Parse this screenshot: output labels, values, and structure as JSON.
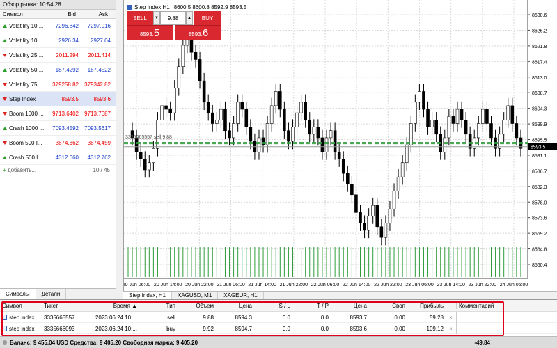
{
  "market_watch": {
    "title": "Обзор рынка: 10:54:28",
    "columns": {
      "symbol": "Символ",
      "bid": "Bid",
      "ask": "Ask"
    },
    "rows": [
      {
        "symbol": "Volatility 10 ...",
        "bid": "7296.842",
        "ask": "7297.016",
        "dir": "up",
        "color": "blue"
      },
      {
        "symbol": "Volatility 10 ...",
        "bid": "2926.34",
        "ask": "2927.04",
        "dir": "up",
        "color": "blue"
      },
      {
        "symbol": "Volatility 25 ...",
        "bid": "2011.294",
        "ask": "2011.414",
        "dir": "down",
        "color": "red"
      },
      {
        "symbol": "Volatility 50 ...",
        "bid": "187.4292",
        "ask": "187.4522",
        "dir": "up",
        "color": "blue"
      },
      {
        "symbol": "Volatility 75 ...",
        "bid": "379258.82",
        "ask": "379342.82",
        "dir": "down",
        "color": "red"
      },
      {
        "symbol": "Step Index",
        "bid": "8593.5",
        "ask": "8593.6",
        "dir": "down",
        "color": "red"
      },
      {
        "symbol": "Boom 1000 ...",
        "bid": "9713.6402",
        "ask": "9713.7687",
        "dir": "down",
        "color": "red"
      },
      {
        "symbol": "Crash 1000 ...",
        "bid": "7093.4592",
        "ask": "7093.5617",
        "dir": "up",
        "color": "blue"
      },
      {
        "symbol": "Boom 500 I...",
        "bid": "3874.362",
        "ask": "3874.459",
        "dir": "down",
        "color": "red"
      },
      {
        "symbol": "Crash 500 I...",
        "bid": "4312.660",
        "ask": "4312.762",
        "dir": "up",
        "color": "blue"
      }
    ],
    "add_label": "добавить...",
    "count": "10 / 45",
    "tabs": [
      "Символы",
      "Детали"
    ]
  },
  "chart": {
    "title": "Step Index,H1",
    "ohlc": "8600.5 8600.8 8592.9 8593.5",
    "sell_label": "SELL",
    "buy_label": "BUY",
    "lot": "9.88",
    "sell_price_small": "8593.",
    "sell_price_big": "5",
    "buy_price_small": "8593.",
    "buy_price_big": "6",
    "trade_line_label": "3335665557 sell 9.88",
    "current_price": "8593.5",
    "y_ticks": [
      "8630.6",
      "8626.2",
      "8621.8",
      "8617.4",
      "8613.0",
      "8608.7",
      "8604.3",
      "8599.9",
      "8595.5",
      "8591.1",
      "8586.7",
      "8582.3",
      "8578.0",
      "8573.6",
      "8569.2",
      "8564.8",
      "8560.4"
    ],
    "x_ticks": [
      "20 Jun 06:00",
      "20 Jun 14:00",
      "20 Jun 22:00",
      "21 Jun 06:00",
      "21 Jun 14:00",
      "21 Jun 22:00",
      "22 Jun 06:00",
      "22 Jun 14:00",
      "22 Jun 22:00",
      "23 Jun 06:00",
      "23 Jun 14:00",
      "23 Jun 22:00",
      "24 Jun 06:00"
    ],
    "tabs": [
      "Step Index, H1",
      "XAGUSD, M1",
      "XAGEUR, H1"
    ]
  },
  "trade": {
    "columns": [
      "Символ",
      "Тикет",
      "Время",
      "Тип",
      "Объем",
      "Цена",
      "S / L",
      "T / P",
      "Цена",
      "Своп",
      "Прибыль",
      "",
      "Комментарий"
    ],
    "rows": [
      {
        "symbol": "step index",
        "ticket": "3335665557",
        "time": "2023.06.24 10:...",
        "type": "sell",
        "volume": "9.88",
        "price": "8594.3",
        "sl": "0.0",
        "tp": "0.0",
        "cur": "8593.7",
        "swap": "0.00",
        "profit": "59.28"
      },
      {
        "symbol": "step index",
        "ticket": "3335666093",
        "time": "2023.06.24 10:...",
        "type": "buy",
        "volume": "9.92",
        "price": "8594.7",
        "sl": "0.0",
        "tp": "0.0",
        "cur": "8593.6",
        "swap": "0.00",
        "profit": "-109.12"
      }
    ],
    "balance_text": "Баланс: 9 455.04 USD  Средства: 9 405.20  Свободная маржа: 9 405.20",
    "total_profit": "-49.84"
  }
}
